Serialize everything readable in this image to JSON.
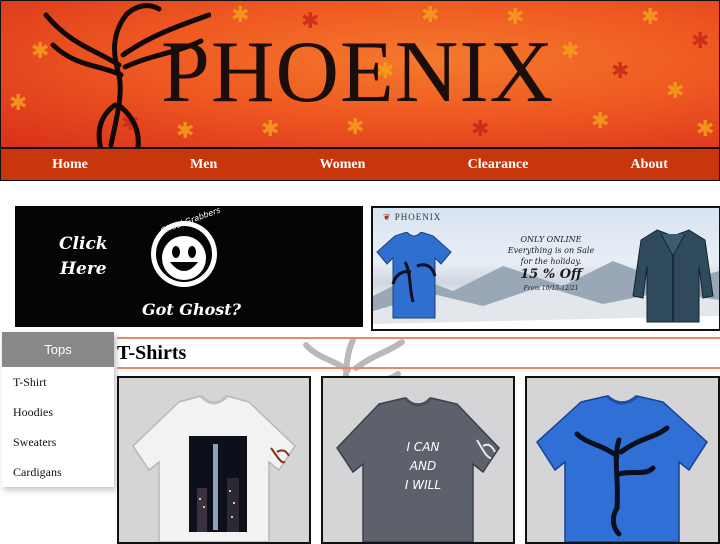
{
  "site": {
    "logo_text": "PHOENIX"
  },
  "nav": {
    "items": [
      {
        "label": "Home"
      },
      {
        "label": "Men"
      },
      {
        "label": "Women"
      },
      {
        "label": "Clearance"
      },
      {
        "label": "About"
      }
    ]
  },
  "ads": {
    "left": {
      "click_line1": "Click",
      "click_line2": "Here",
      "badge_text": "Ghoul Grabbers",
      "tagline": "Got Ghost?"
    },
    "right": {
      "brand": "PHOENIX",
      "line1": "ONLY ONLINE",
      "line2": "Everything is on Sale",
      "line3": "for the holiday.",
      "discount": "15 % Off",
      "dates": "From 10/15-12/21"
    }
  },
  "sidebar": {
    "heading": "Tops",
    "items": [
      {
        "label": "T-Shirt"
      },
      {
        "label": "Hoodies"
      },
      {
        "label": "Sweaters"
      },
      {
        "label": "Cardigans"
      }
    ]
  },
  "main": {
    "section_title": "T-Shirts",
    "products": [
      {
        "color": "white",
        "print": "city-photo"
      },
      {
        "color": "gray",
        "print_text": [
          "I CAN",
          "AND",
          "I WILL"
        ]
      },
      {
        "color": "blue",
        "print": "phoenix-icon"
      }
    ]
  },
  "colors": {
    "nav_bg": "#c8360c",
    "banner_orange": "#ef5a22",
    "accent_rule": "#e68a6e",
    "sidebar_head": "#888888"
  }
}
